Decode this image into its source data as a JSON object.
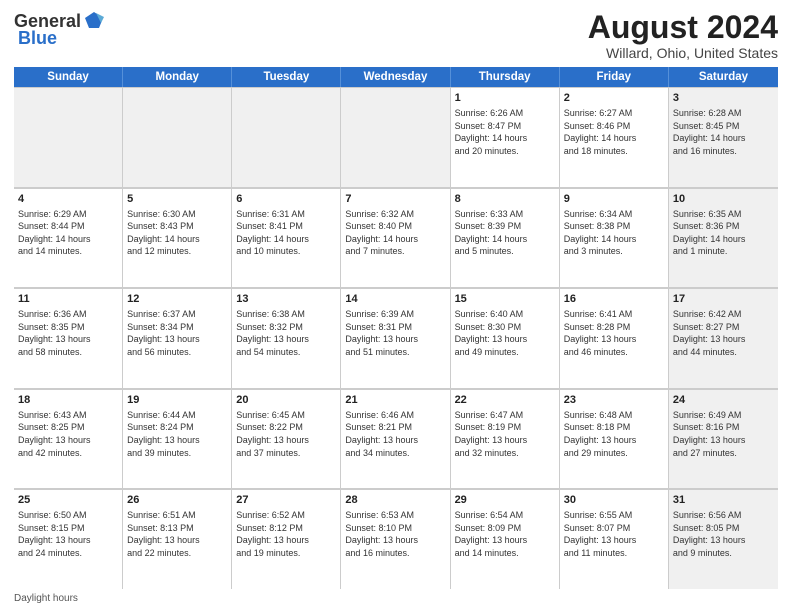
{
  "header": {
    "logo_general": "General",
    "logo_blue": "Blue",
    "month_title": "August 2024",
    "location": "Willard, Ohio, United States"
  },
  "days_of_week": [
    "Sunday",
    "Monday",
    "Tuesday",
    "Wednesday",
    "Thursday",
    "Friday",
    "Saturday"
  ],
  "footer": "Daylight hours",
  "weeks": [
    [
      {
        "day": "",
        "shaded": true,
        "info": ""
      },
      {
        "day": "",
        "shaded": true,
        "info": ""
      },
      {
        "day": "",
        "shaded": true,
        "info": ""
      },
      {
        "day": "",
        "shaded": true,
        "info": ""
      },
      {
        "day": "1",
        "shaded": false,
        "info": "Sunrise: 6:26 AM\nSunset: 8:47 PM\nDaylight: 14 hours\nand 20 minutes."
      },
      {
        "day": "2",
        "shaded": false,
        "info": "Sunrise: 6:27 AM\nSunset: 8:46 PM\nDaylight: 14 hours\nand 18 minutes."
      },
      {
        "day": "3",
        "shaded": true,
        "info": "Sunrise: 6:28 AM\nSunset: 8:45 PM\nDaylight: 14 hours\nand 16 minutes."
      }
    ],
    [
      {
        "day": "4",
        "shaded": false,
        "info": "Sunrise: 6:29 AM\nSunset: 8:44 PM\nDaylight: 14 hours\nand 14 minutes."
      },
      {
        "day": "5",
        "shaded": false,
        "info": "Sunrise: 6:30 AM\nSunset: 8:43 PM\nDaylight: 14 hours\nand 12 minutes."
      },
      {
        "day": "6",
        "shaded": false,
        "info": "Sunrise: 6:31 AM\nSunset: 8:41 PM\nDaylight: 14 hours\nand 10 minutes."
      },
      {
        "day": "7",
        "shaded": false,
        "info": "Sunrise: 6:32 AM\nSunset: 8:40 PM\nDaylight: 14 hours\nand 7 minutes."
      },
      {
        "day": "8",
        "shaded": false,
        "info": "Sunrise: 6:33 AM\nSunset: 8:39 PM\nDaylight: 14 hours\nand 5 minutes."
      },
      {
        "day": "9",
        "shaded": false,
        "info": "Sunrise: 6:34 AM\nSunset: 8:38 PM\nDaylight: 14 hours\nand 3 minutes."
      },
      {
        "day": "10",
        "shaded": true,
        "info": "Sunrise: 6:35 AM\nSunset: 8:36 PM\nDaylight: 14 hours\nand 1 minute."
      }
    ],
    [
      {
        "day": "11",
        "shaded": false,
        "info": "Sunrise: 6:36 AM\nSunset: 8:35 PM\nDaylight: 13 hours\nand 58 minutes."
      },
      {
        "day": "12",
        "shaded": false,
        "info": "Sunrise: 6:37 AM\nSunset: 8:34 PM\nDaylight: 13 hours\nand 56 minutes."
      },
      {
        "day": "13",
        "shaded": false,
        "info": "Sunrise: 6:38 AM\nSunset: 8:32 PM\nDaylight: 13 hours\nand 54 minutes."
      },
      {
        "day": "14",
        "shaded": false,
        "info": "Sunrise: 6:39 AM\nSunset: 8:31 PM\nDaylight: 13 hours\nand 51 minutes."
      },
      {
        "day": "15",
        "shaded": false,
        "info": "Sunrise: 6:40 AM\nSunset: 8:30 PM\nDaylight: 13 hours\nand 49 minutes."
      },
      {
        "day": "16",
        "shaded": false,
        "info": "Sunrise: 6:41 AM\nSunset: 8:28 PM\nDaylight: 13 hours\nand 46 minutes."
      },
      {
        "day": "17",
        "shaded": true,
        "info": "Sunrise: 6:42 AM\nSunset: 8:27 PM\nDaylight: 13 hours\nand 44 minutes."
      }
    ],
    [
      {
        "day": "18",
        "shaded": false,
        "info": "Sunrise: 6:43 AM\nSunset: 8:25 PM\nDaylight: 13 hours\nand 42 minutes."
      },
      {
        "day": "19",
        "shaded": false,
        "info": "Sunrise: 6:44 AM\nSunset: 8:24 PM\nDaylight: 13 hours\nand 39 minutes."
      },
      {
        "day": "20",
        "shaded": false,
        "info": "Sunrise: 6:45 AM\nSunset: 8:22 PM\nDaylight: 13 hours\nand 37 minutes."
      },
      {
        "day": "21",
        "shaded": false,
        "info": "Sunrise: 6:46 AM\nSunset: 8:21 PM\nDaylight: 13 hours\nand 34 minutes."
      },
      {
        "day": "22",
        "shaded": false,
        "info": "Sunrise: 6:47 AM\nSunset: 8:19 PM\nDaylight: 13 hours\nand 32 minutes."
      },
      {
        "day": "23",
        "shaded": false,
        "info": "Sunrise: 6:48 AM\nSunset: 8:18 PM\nDaylight: 13 hours\nand 29 minutes."
      },
      {
        "day": "24",
        "shaded": true,
        "info": "Sunrise: 6:49 AM\nSunset: 8:16 PM\nDaylight: 13 hours\nand 27 minutes."
      }
    ],
    [
      {
        "day": "25",
        "shaded": false,
        "info": "Sunrise: 6:50 AM\nSunset: 8:15 PM\nDaylight: 13 hours\nand 24 minutes."
      },
      {
        "day": "26",
        "shaded": false,
        "info": "Sunrise: 6:51 AM\nSunset: 8:13 PM\nDaylight: 13 hours\nand 22 minutes."
      },
      {
        "day": "27",
        "shaded": false,
        "info": "Sunrise: 6:52 AM\nSunset: 8:12 PM\nDaylight: 13 hours\nand 19 minutes."
      },
      {
        "day": "28",
        "shaded": false,
        "info": "Sunrise: 6:53 AM\nSunset: 8:10 PM\nDaylight: 13 hours\nand 16 minutes."
      },
      {
        "day": "29",
        "shaded": false,
        "info": "Sunrise: 6:54 AM\nSunset: 8:09 PM\nDaylight: 13 hours\nand 14 minutes."
      },
      {
        "day": "30",
        "shaded": false,
        "info": "Sunrise: 6:55 AM\nSunset: 8:07 PM\nDaylight: 13 hours\nand 11 minutes."
      },
      {
        "day": "31",
        "shaded": true,
        "info": "Sunrise: 6:56 AM\nSunset: 8:05 PM\nDaylight: 13 hours\nand 9 minutes."
      }
    ]
  ]
}
